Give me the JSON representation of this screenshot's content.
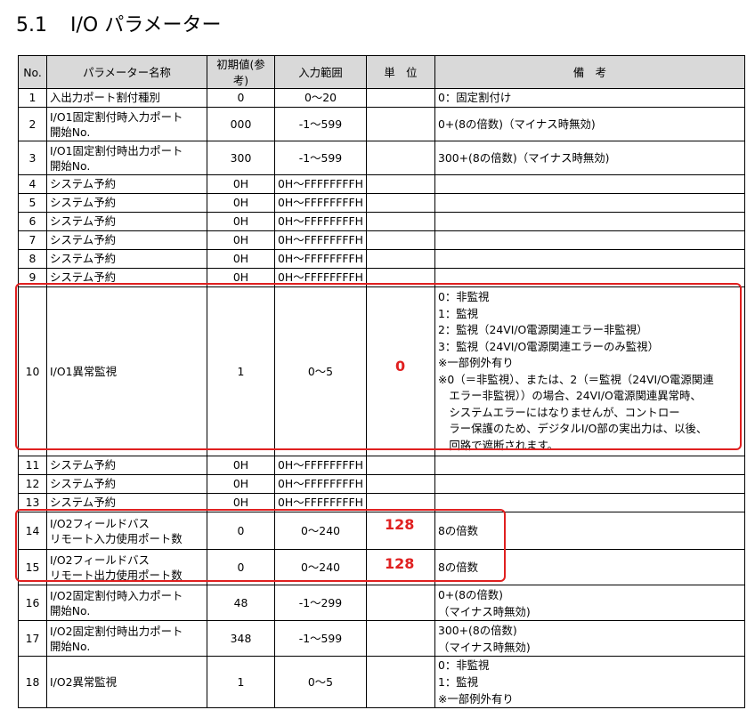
{
  "heading": {
    "number": "5.1",
    "title": "I/O パラメーター"
  },
  "table": {
    "headers": [
      "No.",
      "パラメーター名称",
      "初期値(参考)",
      "入力範囲",
      "単　位",
      "備　考"
    ],
    "rows": [
      {
        "no": "1",
        "name": "入出力ポート割付種別",
        "default": "0",
        "range": "0～20",
        "unit": "",
        "note": "0：固定割付け"
      },
      {
        "no": "2",
        "name": "I/O1固定割付時入力ポート\n開始No.",
        "default": "000",
        "range": "-1～599",
        "unit": "",
        "note": "0+(8の倍数)（マイナス時無効)"
      },
      {
        "no": "3",
        "name": "I/O1固定割付時出力ポート\n開始No.",
        "default": "300",
        "range": "-1～599",
        "unit": "",
        "note": "300+(8の倍数)（マイナス時無効)"
      },
      {
        "no": "4",
        "name": "システム予約",
        "default": "0H",
        "range": "0H～FFFFFFFFH",
        "unit": "",
        "note": ""
      },
      {
        "no": "5",
        "name": "システム予約",
        "default": "0H",
        "range": "0H～FFFFFFFFH",
        "unit": "",
        "note": ""
      },
      {
        "no": "6",
        "name": "システム予約",
        "default": "0H",
        "range": "0H～FFFFFFFFH",
        "unit": "",
        "note": ""
      },
      {
        "no": "7",
        "name": "システム予約",
        "default": "0H",
        "range": "0H～FFFFFFFFH",
        "unit": "",
        "note": ""
      },
      {
        "no": "8",
        "name": "システム予約",
        "default": "0H",
        "range": "0H～FFFFFFFFH",
        "unit": "",
        "note": ""
      },
      {
        "no": "9",
        "name": "システム予約",
        "default": "0H",
        "range": "0H～FFFFFFFFH",
        "unit": "",
        "note": ""
      },
      {
        "no": "10",
        "name": "I/O1異常監視",
        "default": "1",
        "range": "0～5",
        "unit": "",
        "note": "0：非監視\n1：監視\n2：監視（24VI/O電源関連エラー非監視）\n3：監視（24VI/O電源関連エラーのみ監視）\n※一部例外有り\n※0（＝非監視）、または、2（＝監視（24VI/O電源関連\n　エラー非監視））の場合、24VI/O電源関連異常時、\n　システムエラーにはなりませんが、コントロー\n　ラー保護のため、デジタルI/O部の実出力は、以後、\n　回路で遮断されます。"
      },
      {
        "no": "11",
        "name": "システム予約",
        "default": "0H",
        "range": "0H～FFFFFFFFH",
        "unit": "",
        "note": ""
      },
      {
        "no": "12",
        "name": "システム予約",
        "default": "0H",
        "range": "0H～FFFFFFFFH",
        "unit": "",
        "note": ""
      },
      {
        "no": "13",
        "name": "システム予約",
        "default": "0H",
        "range": "0H～FFFFFFFFH",
        "unit": "",
        "note": ""
      },
      {
        "no": "14",
        "name": "I/O2フィールドバス\nリモート入力使用ポート数",
        "default": "0",
        "range": "0～240",
        "unit": "",
        "note": "8の倍数"
      },
      {
        "no": "15",
        "name": "I/O2フィールドバス\nリモート出力使用ポート数",
        "default": "0",
        "range": "0～240",
        "unit": "",
        "note": "8の倍数"
      },
      {
        "no": "16",
        "name": "I/O2固定割付時入力ポート\n開始No.",
        "default": "48",
        "range": "-1～299",
        "unit": "",
        "note": "0+(8の倍数)\n（マイナス時無効)"
      },
      {
        "no": "17",
        "name": "I/O2固定割付時出力ポート\n開始No.",
        "default": "348",
        "range": "-1～599",
        "unit": "",
        "note": "300+(8の倍数)\n（マイナス時無効)"
      },
      {
        "no": "18",
        "name": "I/O2異常監視",
        "default": "1",
        "range": "0～5",
        "unit": "",
        "note": "0：非監視\n1：監視\n※一部例外有り"
      }
    ]
  },
  "annotations": {
    "row10_value": "0",
    "row14_value": "128",
    "row15_value": "128",
    "color": "#e02020"
  }
}
